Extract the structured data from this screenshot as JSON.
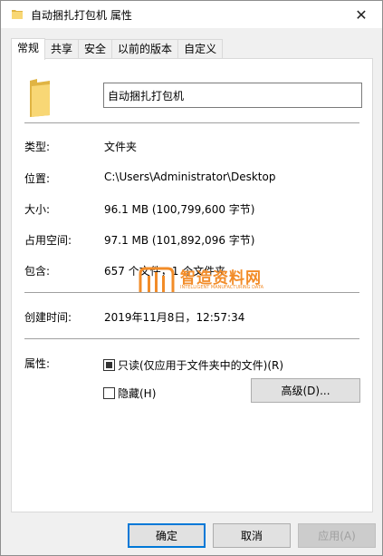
{
  "window": {
    "title": "自动捆扎打包机 属性",
    "close_glyph": "✕"
  },
  "tabs": [
    {
      "label": "常规",
      "active": true
    },
    {
      "label": "共享",
      "active": false
    },
    {
      "label": "安全",
      "active": false
    },
    {
      "label": "以前的版本",
      "active": false
    },
    {
      "label": "自定义",
      "active": false
    }
  ],
  "general": {
    "folder_name": "自动捆扎打包机",
    "type_label": "类型:",
    "type_value": "文件夹",
    "location_label": "位置:",
    "location_value": "C:\\Users\\Administrator\\Desktop",
    "size_label": "大小:",
    "size_value": "96.1 MB (100,799,600 字节)",
    "disk_size_label": "占用空间:",
    "disk_size_value": "97.1 MB (101,892,096 字节)",
    "contains_label": "包含:",
    "contains_value": "657 个文件，1 个文件夹",
    "created_label": "创建时间:",
    "created_value": "2019年11月8日，12:57:34",
    "attributes_label": "属性:",
    "readonly_label": "只读(仅应用于文件夹中的文件)(R)",
    "hidden_label": "隐藏(H)",
    "advanced_button": "高级(D)..."
  },
  "buttons": {
    "ok": "确定",
    "cancel": "取消",
    "apply": "应用(A)"
  },
  "watermark": {
    "text": "智造资料网",
    "subtext": "INTELLIGENT MANUFACTURING DATA",
    "color": "#f28c28"
  },
  "colors": {
    "folder_yellow": "#f8d775",
    "folder_dark": "#e0b443",
    "focus_blue": "#0078d7"
  }
}
